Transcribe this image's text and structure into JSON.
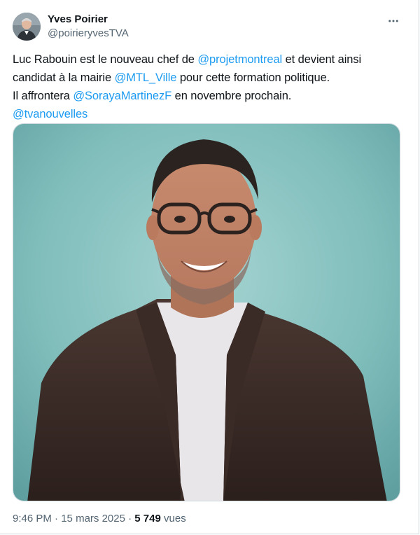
{
  "author": {
    "display_name": "Yves Poirier",
    "handle": "@poirieryvesTVA"
  },
  "tweet": {
    "lines": [
      [
        {
          "t": "Luc Rabouin est le nouveau chef de ",
          "m": false
        },
        {
          "t": "@projetmontreal",
          "m": true
        },
        {
          "t": " et devient ainsi",
          "m": false
        }
      ],
      [
        {
          "t": "candidat à la mairie ",
          "m": false
        },
        {
          "t": "@MTL_Ville",
          "m": true
        },
        {
          "t": " pour cette formation politique.",
          "m": false
        }
      ],
      [
        {
          "t": "Il affrontera ",
          "m": false
        },
        {
          "t": "@SorayaMartinezF",
          "m": true
        },
        {
          "t": " en novembre prochain.",
          "m": false
        }
      ],
      [
        {
          "t": "@tvanouvelles",
          "m": true
        }
      ]
    ]
  },
  "meta": {
    "time": "9:46 PM",
    "separator": " · ",
    "date": "15 mars 2025",
    "views_count": "5 749",
    "views_label": " vues"
  },
  "icons": {
    "more": "more-horizontal-icon"
  },
  "colors": {
    "mention": "#1d9bf0",
    "text": "#0f1419",
    "secondary": "#536471",
    "photo_background": "#8cc4c2",
    "jacket": "#3a2a26"
  }
}
